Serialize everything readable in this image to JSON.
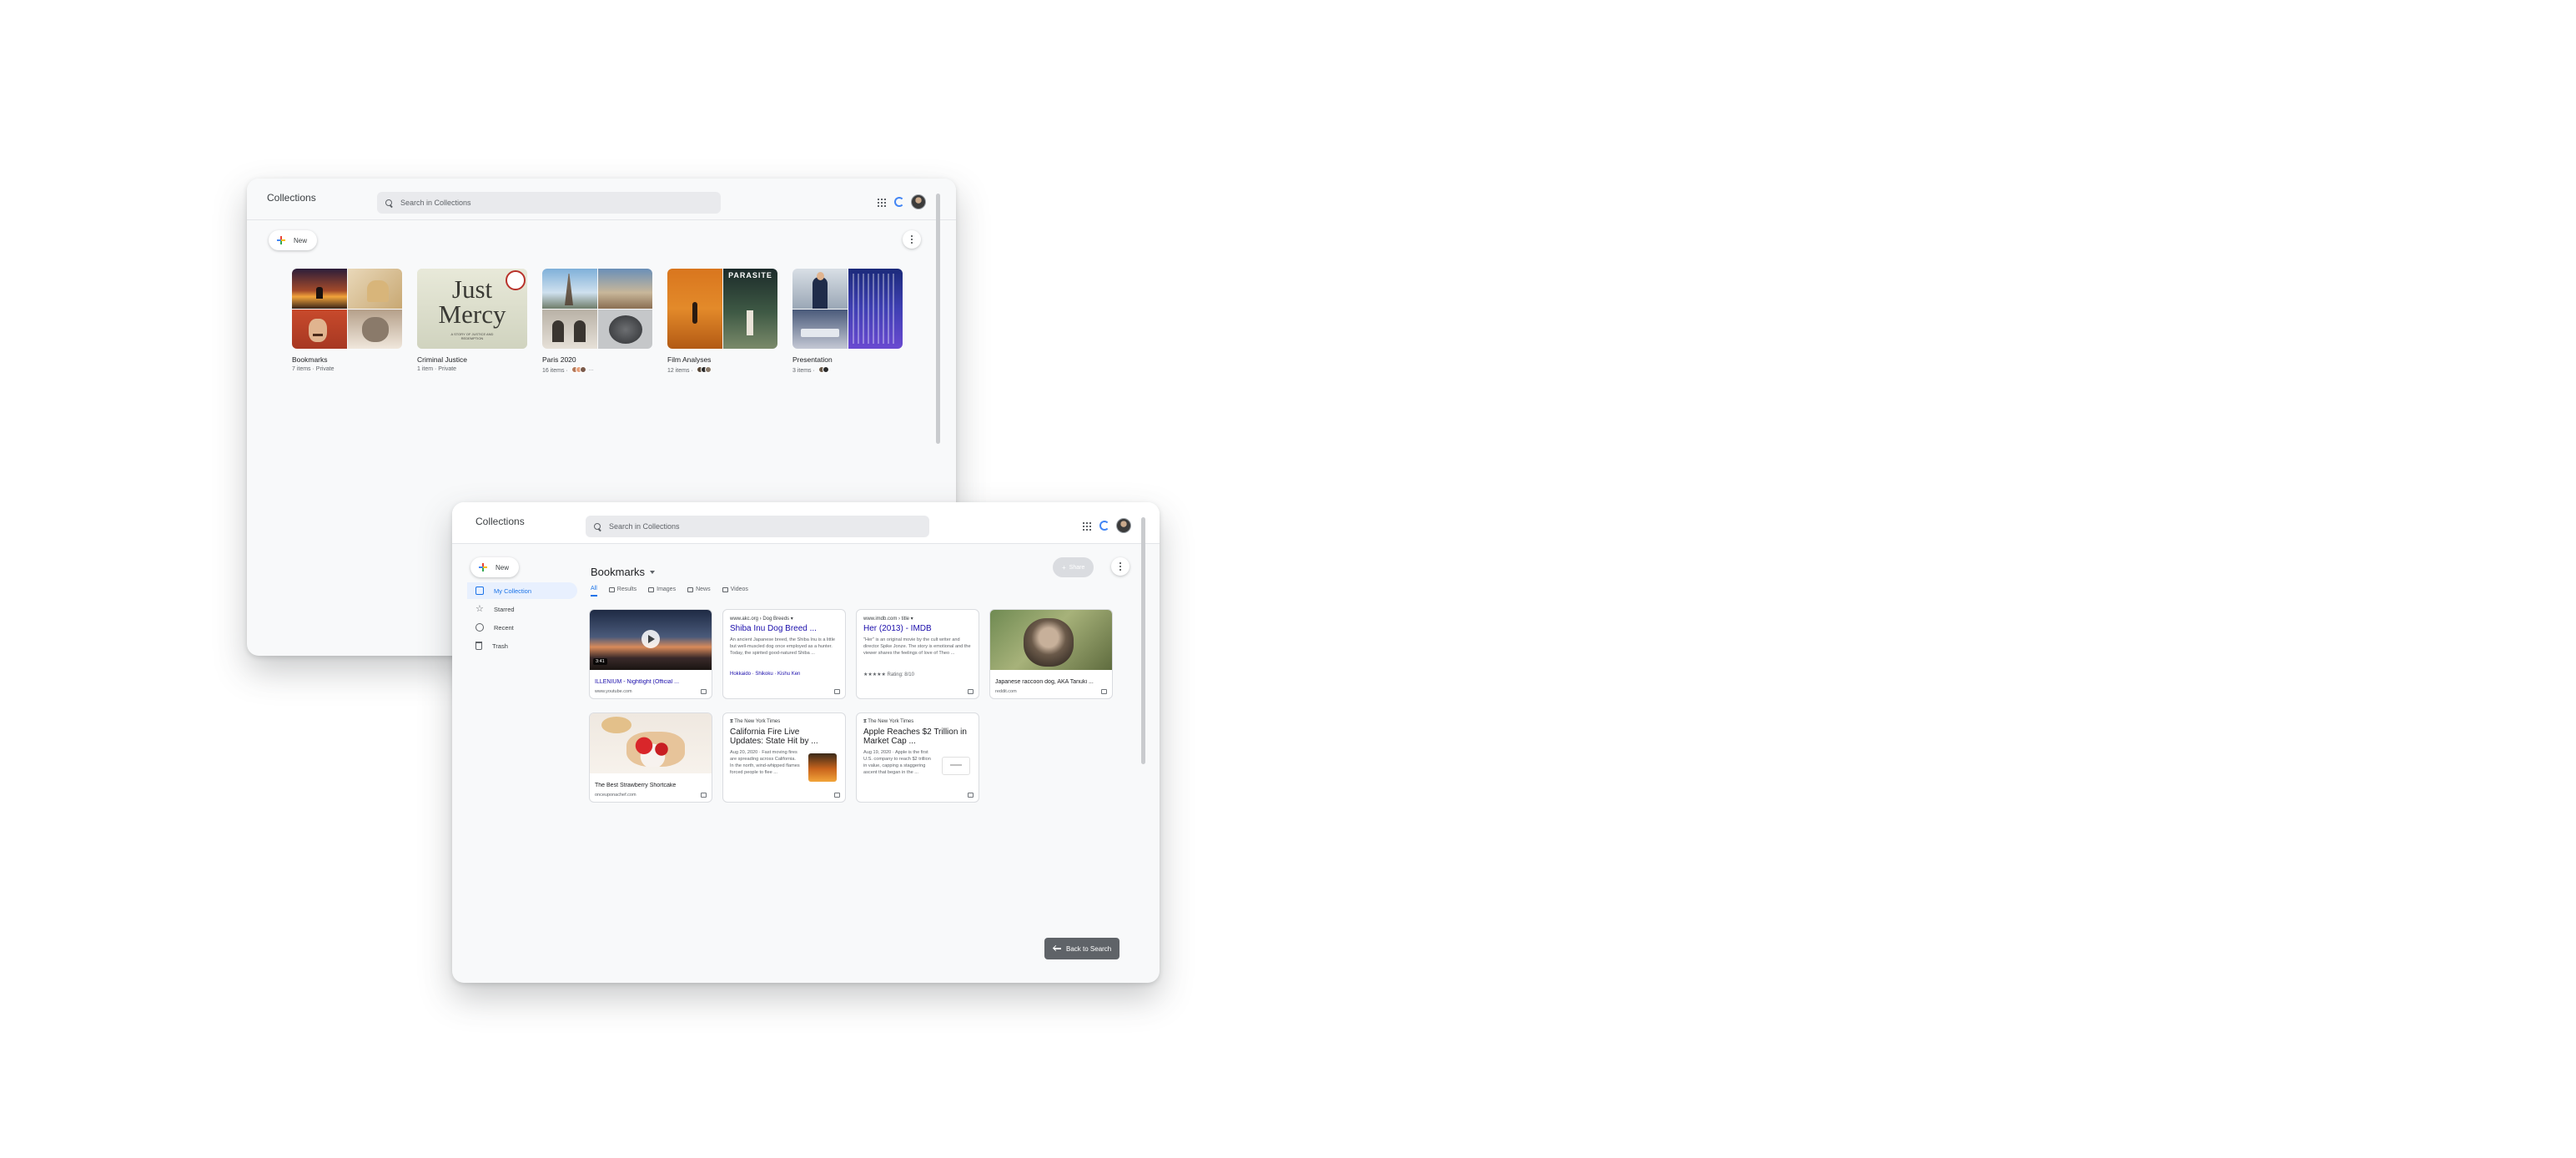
{
  "back_window": {
    "app_title": "Collections",
    "search": {
      "placeholder": "Search in Collections"
    },
    "new_label": "New",
    "collections": [
      {
        "name": "Bookmarks",
        "meta": "7 items · Private"
      },
      {
        "name": "Criminal Justice",
        "meta": "1 item · Private"
      },
      {
        "name": "Paris 2020",
        "meta": "16 items ·"
      },
      {
        "name": "Film Analyses",
        "meta": "12 items ·"
      },
      {
        "name": "Presentation",
        "meta": "3 items ·"
      }
    ],
    "book_cover": {
      "title_line1": "Just",
      "title_line2": "Mercy",
      "subtitle": "A STORY OF JUSTICE AND REDEMPTION"
    },
    "parasite_poster": {
      "title": "PARASITE"
    }
  },
  "front_window": {
    "app_title": "Collections",
    "search": {
      "placeholder": "Search in Collections"
    },
    "new_label": "New",
    "sidebar": [
      {
        "label": "My Collection",
        "icon": "my-collection-icon"
      },
      {
        "label": "Starred",
        "icon": "star-icon"
      },
      {
        "label": "Recent",
        "icon": "clock-icon"
      },
      {
        "label": "Trash",
        "icon": "trash-icon"
      }
    ],
    "heading": "Bookmarks",
    "share_label": "Share",
    "tabs": [
      "All",
      "Results",
      "Images",
      "News",
      "Videos"
    ],
    "cards": {
      "video": {
        "duration": "3:41",
        "title": "ILLENIUM - Nightlight (Official ...",
        "source": "www.youtube.com"
      },
      "shiba": {
        "source": "www.akc.org › Dog Breeds ▾",
        "title": "Shiba Inu Dog Breed ...",
        "snippet": "An ancient Japanese breed, the Shiba Inu is a little but well-muscled dog once employed as a hunter. Today, the spirited good-natured Shiba ...",
        "links": "Hokkaido · Shikoku · Kishu Ken"
      },
      "imdb": {
        "source": "www.imdb.com › title ▾",
        "title": "Her (2013) - IMDB",
        "snippet": "\"Her\" is an original movie by the cult writer and director Spike Jonze. The story is emotional and the viewer shares the feelings of love of Theo ...",
        "rating": "★★★★★ Rating: 8/10"
      },
      "raccoon": {
        "title": "Japanese raccoon dog, AKA Tanuki ...",
        "source": "reddit.com"
      },
      "shortcake": {
        "title": "The Best Strawberry Shortcake",
        "source": "onceuponachef.com"
      },
      "fire": {
        "publisher": "The New York Times",
        "title": "California Fire Live Updates: State Hit by ...",
        "snippet": "Aug 20, 2020 · Fast moving fires are spreading across California. In the north, wind-whipped flames forced people to flee ..."
      },
      "apple": {
        "publisher": "The New York Times",
        "title": "Apple Reaches $2 Trillion in Market Cap ...",
        "snippet": "Aug 19, 2020 · Apple is the first U.S. company to reach $2 trillion in value, capping a staggering ascent that began in the ..."
      }
    },
    "back_to_search": "Back to Search"
  }
}
